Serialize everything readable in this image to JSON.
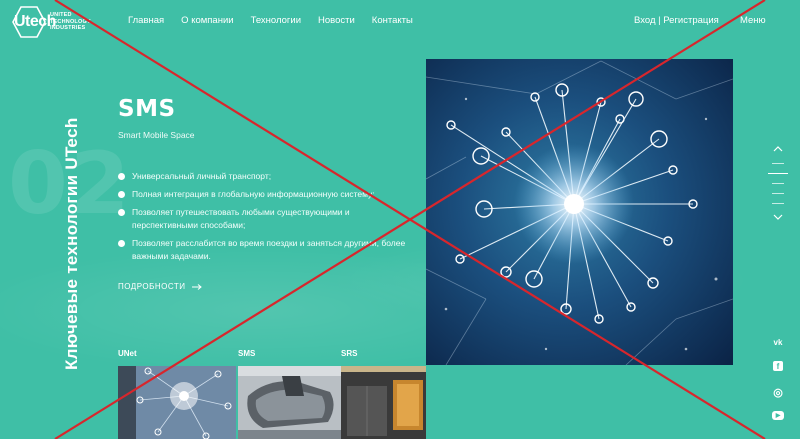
{
  "header": {
    "logo_mark": "Utech",
    "logo_lines": [
      "UNITED",
      "TECHNOLOGY",
      "INDUSTRIES"
    ],
    "nav": [
      {
        "label": "Главная"
      },
      {
        "label": "О компании"
      },
      {
        "label": "Технологии"
      },
      {
        "label": "Новости"
      },
      {
        "label": "Контакты"
      }
    ],
    "auth": "Вход | Регистрация",
    "menu": "Меню"
  },
  "side": {
    "vertical_title": "Ключевые технологии UTech",
    "bg_number": "02"
  },
  "main": {
    "title": "SMS",
    "subtitle": "Smart Mobile Space",
    "features": [
      "Универсальный личный транспорт;",
      "Полная интеграция в глобальную информационную систему;",
      "Позволяет путешествовать любыми существующими и перспективными способами;",
      "Позволяет расслабится во время поездки и заняться другими, более важными задачами."
    ],
    "more_label": "ПОДРОБНОСТИ"
  },
  "thumbnails": [
    {
      "label": "UNet"
    },
    {
      "label": "SMS"
    },
    {
      "label": "SRS"
    }
  ],
  "colors": {
    "background": "#3fbfa6",
    "cross": "#d8262c",
    "image_dark": "#0d2d55"
  },
  "icons": [
    "hexagon-logo-icon",
    "arrow-right-icon",
    "chevron-up-icon",
    "chevron-down-icon",
    "vk-icon",
    "facebook-icon",
    "instagram-icon",
    "youtube-icon"
  ],
  "socials": [
    {
      "glyph": "vk"
    },
    {
      "glyph": "f"
    },
    {
      "glyph": "◎"
    },
    {
      "glyph": "▶"
    }
  ]
}
